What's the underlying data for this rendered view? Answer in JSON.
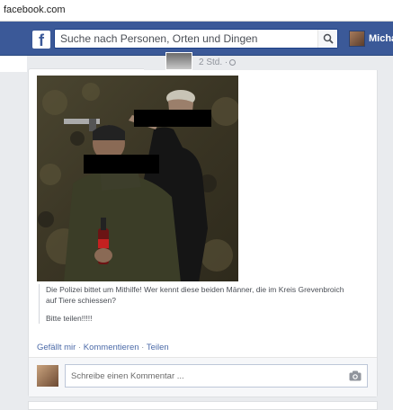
{
  "browser": {
    "url": "facebook.com"
  },
  "header": {
    "logo_letter": "f",
    "search_placeholder": "Suche nach Personen, Orten und Dingen",
    "profile_name": "Micha",
    "brand_color": "#3b5998"
  },
  "previous_post": {
    "time": "2 Std. ·"
  },
  "post": {
    "text_line1": "Die Polizei bittet um Mithilfe! Wer kennt diese beiden Männer, die im Kreis Grevenbroich auf Tiere schiessen?",
    "text_line2": "Bitte teilen!!!!!",
    "actions": {
      "like": "Gefällt mir",
      "comment": "Kommentieren",
      "share": "Teilen",
      "separator": "·"
    }
  },
  "comment": {
    "placeholder": "Schreibe einen Kommentar ..."
  },
  "icons": [
    "facebook-logo",
    "search-icon",
    "globe-icon",
    "camera-icon"
  ]
}
